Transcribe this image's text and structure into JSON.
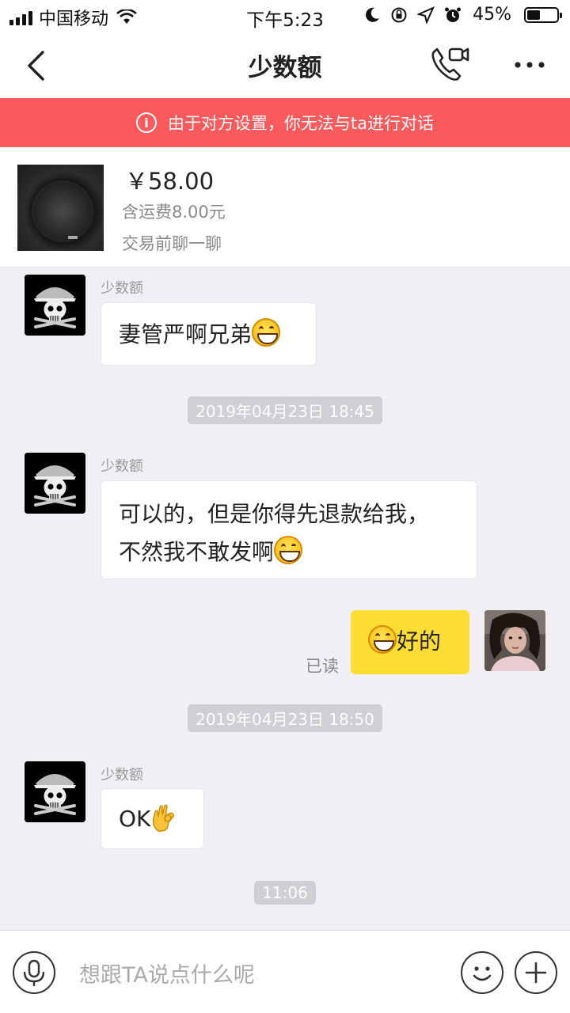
{
  "status_bar": {
    "carrier": "中国移动",
    "time": "下午5:23",
    "battery_pct": "45%",
    "battery_level": 0.45
  },
  "nav": {
    "title": "少数额"
  },
  "banner": {
    "icon": "info-icon",
    "glyph": "i",
    "text": "由于对方设置，你无法与ta进行对话",
    "color": "#fb5a5c"
  },
  "product": {
    "price": "￥58.00",
    "shipping": "含运费8.00元",
    "note": "交易前聊一聊"
  },
  "messages": [
    {
      "sender": "少数额",
      "text": "妻管严啊兄弟",
      "emoji": "grin-emoji"
    },
    {
      "sender": "少数额",
      "line1": "可以的，但是你得先退款给我，",
      "line2": "不然我不敢发啊",
      "emoji": "grin-emoji"
    },
    {
      "sender": "me",
      "text": "好的",
      "emoji": "grin-emoji",
      "status": "已读"
    },
    {
      "sender": "少数额",
      "text": "OK",
      "emoji": "ok-hand-emoji"
    }
  ],
  "timestamps": [
    "2019年04月23日 18:45",
    "2019年04月23日 18:50",
    "11:06"
  ],
  "input": {
    "placeholder": "想跟TA说点什么呢"
  },
  "colors": {
    "accent_yellow": "#ffdd33",
    "warning_red": "#fb5a5c",
    "chat_bg": "#f0f0f4"
  }
}
